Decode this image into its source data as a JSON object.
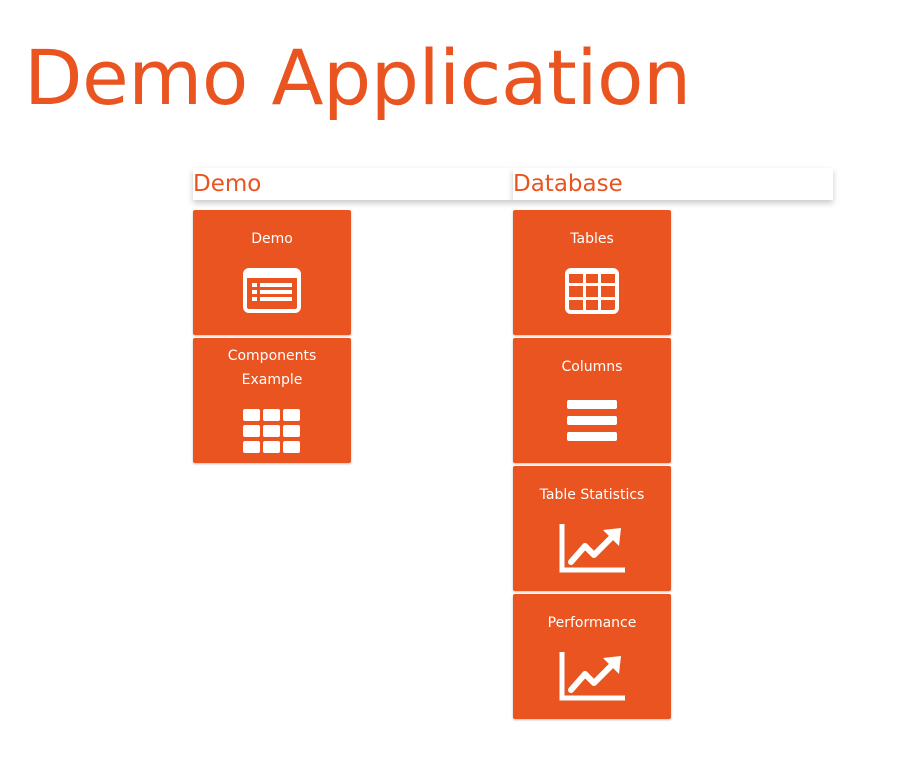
{
  "app": {
    "title": "Demo Application"
  },
  "sections": {
    "demo": {
      "title": "Demo",
      "tiles": [
        {
          "label": "Demo",
          "icon": "list-alt-icon"
        },
        {
          "label": "Components Example",
          "icon": "grid-icon"
        }
      ]
    },
    "database": {
      "title": "Database",
      "tiles": [
        {
          "label": "Tables",
          "icon": "table-icon"
        },
        {
          "label": "Columns",
          "icon": "bars-icon"
        },
        {
          "label": "Table Statistics",
          "icon": "line-chart-icon"
        },
        {
          "label": "Performance",
          "icon": "line-chart-icon"
        }
      ]
    }
  },
  "colors": {
    "accent": "#e95420",
    "tile_text": "#ffffff",
    "background": "#ffffff"
  }
}
